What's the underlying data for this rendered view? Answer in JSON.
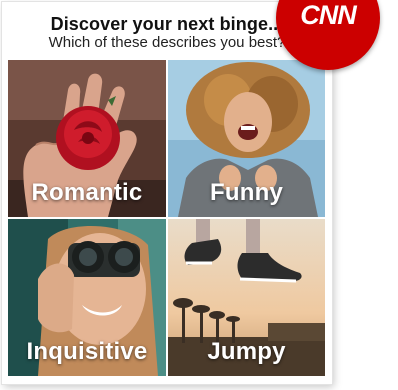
{
  "header": {
    "title": "Discover your next binge...",
    "subtitle": "Which of these describes you best?"
  },
  "tiles": [
    {
      "label": "Romantic"
    },
    {
      "label": "Funny"
    },
    {
      "label": "Inquisitive"
    },
    {
      "label": "Jumpy"
    }
  ],
  "brand": {
    "logo_text": "CNN",
    "color": "#cc0000"
  }
}
